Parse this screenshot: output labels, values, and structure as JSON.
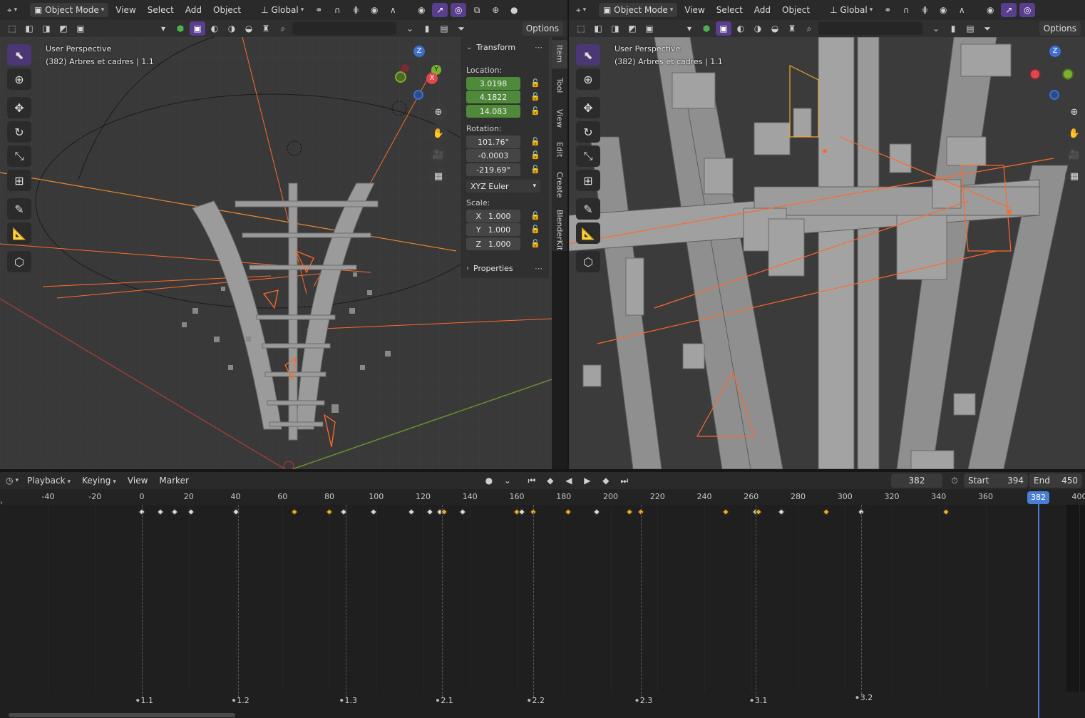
{
  "left": {
    "header": {
      "mode": "Object Mode",
      "menus": [
        "View",
        "Select",
        "Add",
        "Object"
      ],
      "orientation": "Global"
    },
    "header2": {
      "options": "Options"
    },
    "overlay": {
      "perspective": "User Perspective",
      "object": "(382) Arbres et cadres | 1.1"
    },
    "gizmo": {
      "z": "Z",
      "y": "Y",
      "x": "X"
    },
    "npanel": {
      "transform_title": "Transform",
      "location_label": "Location:",
      "location": [
        "3.0198",
        "4.1822",
        "14.083"
      ],
      "rotation_label": "Rotation:",
      "rotation": [
        "101.76°",
        "-0.0003",
        "-219.69°"
      ],
      "rotation_mode": "XYZ Euler",
      "scale_label": "Scale:",
      "scale": [
        {
          "axis": "X",
          "value": "1.000"
        },
        {
          "axis": "Y",
          "value": "1.000"
        },
        {
          "axis": "Z",
          "value": "1.000"
        }
      ],
      "properties_title": "Properties"
    },
    "tabs": [
      "Item",
      "Tool",
      "View",
      "Edit",
      "Create",
      "BlenderKit"
    ]
  },
  "right": {
    "header": {
      "mode": "Object Mode",
      "menus": [
        "View",
        "Select",
        "Add",
        "Object"
      ],
      "orientation": "Global"
    },
    "header2": {
      "options": "Options"
    },
    "overlay": {
      "perspective": "User Perspective",
      "object": "(382) Arbres et cadres | 1.1"
    }
  },
  "timeline": {
    "menus": [
      "Playback",
      "Keying",
      "View",
      "Marker"
    ],
    "current_frame": "382",
    "start_label": "Start",
    "start": "394",
    "end_label": "End",
    "end": "450",
    "ticks": [
      "-40",
      "-20",
      "0",
      "20",
      "40",
      "60",
      "80",
      "100",
      "120",
      "140",
      "160",
      "180",
      "200",
      "220",
      "240",
      "260",
      "280",
      "300",
      "320",
      "340",
      "360",
      "400"
    ],
    "playhead": "382",
    "markers": [
      "1.1",
      "1.2",
      "1.3",
      "2.1",
      "2.2",
      "2.3",
      "3.1",
      "3.2"
    ]
  },
  "colors": {
    "accent": "#5a3e8e",
    "green_field": "#4f8a3a",
    "keyframe_selected": "#f0a92b",
    "keyframe": "#d9d9d9",
    "playhead": "#4a7fd6",
    "camera_lines": "#ff6a2a"
  }
}
